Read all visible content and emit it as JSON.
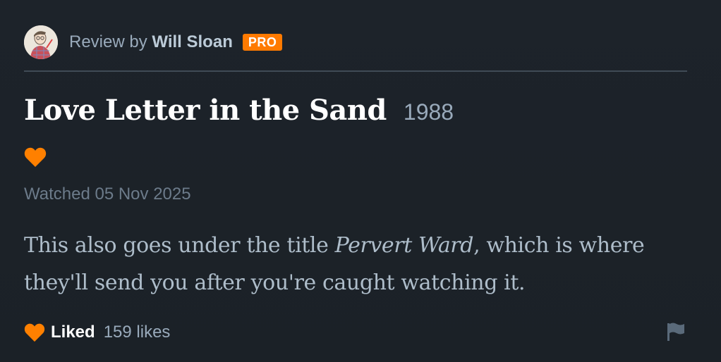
{
  "header": {
    "prefix": "Review by",
    "reviewer_name": "Will Sloan",
    "badge": "PRO"
  },
  "film": {
    "title": "Love Letter in the Sand",
    "year": "1988"
  },
  "watched": "Watched 05 Nov 2025",
  "review": {
    "part1": "This also goes under the title ",
    "italic_title": "Pervert Ward",
    "part2": ", which is where they'll send you after you're caught watching it."
  },
  "footer": {
    "liked_label": "Liked",
    "likes_count": "159 likes"
  },
  "colors": {
    "background": "#1c2228",
    "accent_orange": "#ff8000",
    "pro_badge": "#ff7a00"
  },
  "icons": {
    "like": "heart-icon",
    "report": "flag-icon",
    "avatar": "user-avatar"
  }
}
